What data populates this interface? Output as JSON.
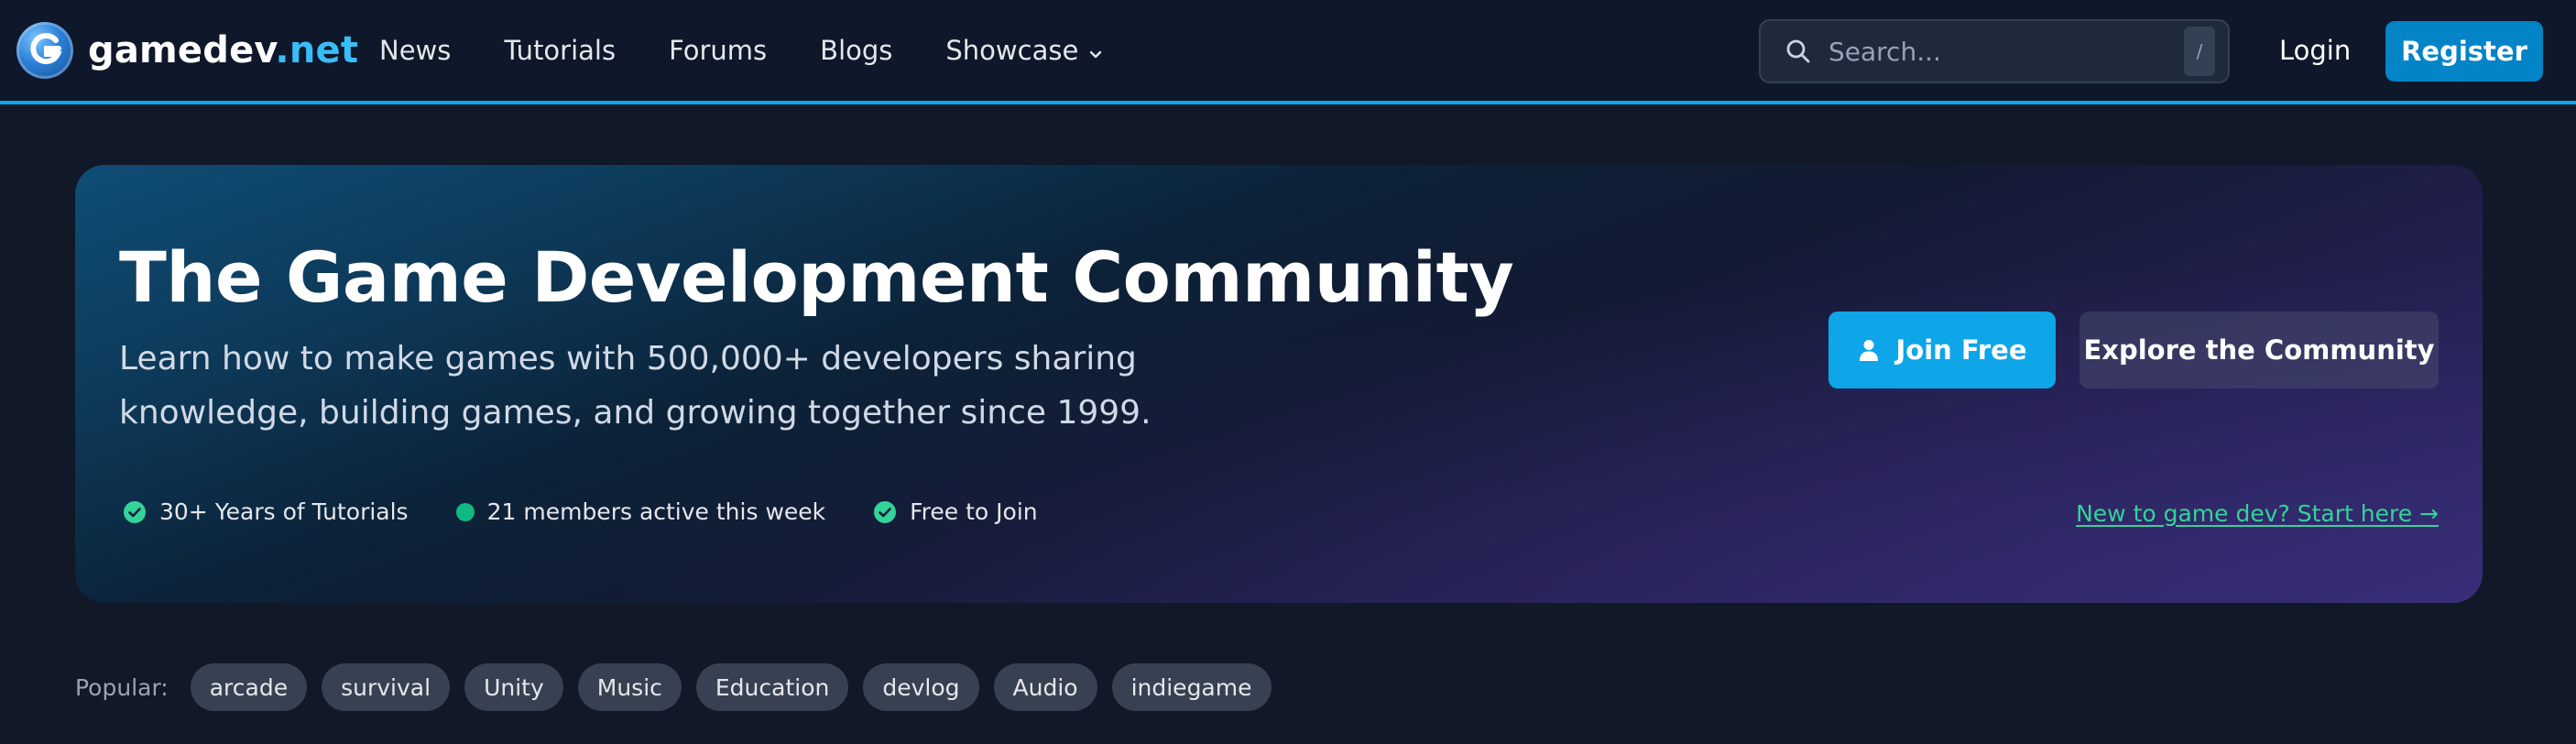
{
  "header": {
    "logo": {
      "name": "gamedev",
      "tld": ".net",
      "icon": "gamedev-logo-icon"
    },
    "nav": [
      {
        "label": "News"
      },
      {
        "label": "Tutorials"
      },
      {
        "label": "Forums"
      },
      {
        "label": "Blogs"
      },
      {
        "label": "Showcase",
        "icon": "chevron-down-icon"
      }
    ],
    "search": {
      "placeholder": "Search...",
      "value": "",
      "shortcut": "/",
      "icon": "search-icon"
    },
    "login_label": "Login",
    "register_label": "Register"
  },
  "hero": {
    "title": "The Game Development Community",
    "subtitle": "Learn how to make games with 500,000+ developers sharing knowledge, building games, and growing together since 1999.",
    "features": [
      {
        "label": "30+ Years of Tutorials",
        "icon": "check-circle-icon"
      },
      {
        "label": "21 members active this week",
        "icon": "status-dot-icon"
      },
      {
        "label": "Free to Join",
        "icon": "check-circle-icon"
      }
    ],
    "join_label": "Join Free",
    "join_icon": "user-icon",
    "explore_label": "Explore the Community",
    "start_link": "New to game dev? Start here →"
  },
  "popular": {
    "label": "Popular:",
    "tags": [
      "arcade",
      "survival",
      "Unity",
      "Music",
      "Education",
      "devlog",
      "Audio",
      "indiegame"
    ]
  },
  "colors": {
    "background": "#111827",
    "header_bg": "#0f172a",
    "accent": "#0ea5e9",
    "register": "#0284c7",
    "link": "#34d399",
    "status_green": "#10b981",
    "tag_bg": "#374151"
  }
}
